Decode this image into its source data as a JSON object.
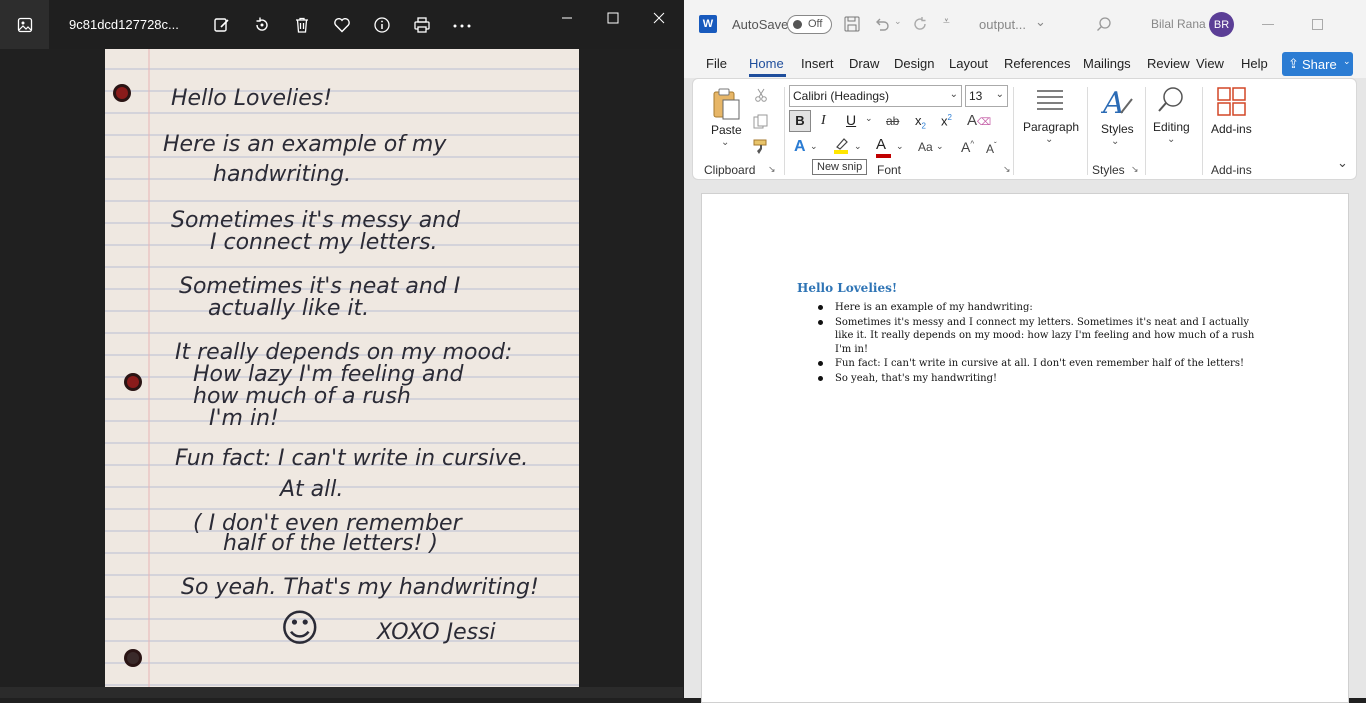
{
  "photos": {
    "title": "9c81dcd127728c...",
    "tools": [
      "edit-image-icon",
      "rotate-icon",
      "delete-icon",
      "favorite-icon",
      "info-icon",
      "print-icon",
      "more-icon"
    ],
    "note_lines": [
      "Hello Lovelies!",
      "Here is an example of my",
      "handwriting.",
      "Sometimes it's messy and",
      "I connect my letters.",
      "Sometimes it's neat and I",
      "actually like it.",
      "It really depends on my mood:",
      "How lazy I'm feeling and",
      "how much of a rush",
      "I'm in!",
      "Fun fact: I can't write in cursive.",
      "At all.",
      "( I don't even remember",
      "half of the letters! )",
      "So yeah. That's my handwriting!",
      "☺",
      "XOXO Jessi"
    ]
  },
  "word": {
    "autosave": "AutoSave",
    "toggle": "Off",
    "filename": "output...",
    "user": "Bilal Rana",
    "initials": "BR",
    "tabs": [
      "File",
      "Home",
      "Insert",
      "Draw",
      "Design",
      "Layout",
      "References",
      "Mailings",
      "Review",
      "View",
      "Help"
    ],
    "share": "Share",
    "font": "Calibri (Headings)",
    "size": "13",
    "paste": "Paste",
    "paragraph": "Paragraph",
    "styles": "Styles",
    "editing": "Editing",
    "addins": "Add-ins",
    "groups": {
      "clipboard": "Clipboard",
      "font": "Font",
      "styles": "Styles",
      "addins": "Add-ins"
    },
    "tooltip": "New snip",
    "doc": {
      "heading": "Hello Lovelies!",
      "bullets": [
        "Here is an example of my handwriting:",
        "Sometimes it's messy and I connect my letters. Sometimes it's neat and I actually like it. It really depends on my mood: how lazy I'm feeling and how much of a rush I'm in!",
        "Fun fact: I can't write in cursive at all. I don't even remember half of the letters!",
        "So yeah, that's my handwriting!"
      ]
    },
    "colors": {
      "accent": "#2b7cd3",
      "heading": "#2e74b5",
      "avatar": "#5b3e96",
      "red": "#c00000",
      "highlight": "#ffe600"
    }
  }
}
